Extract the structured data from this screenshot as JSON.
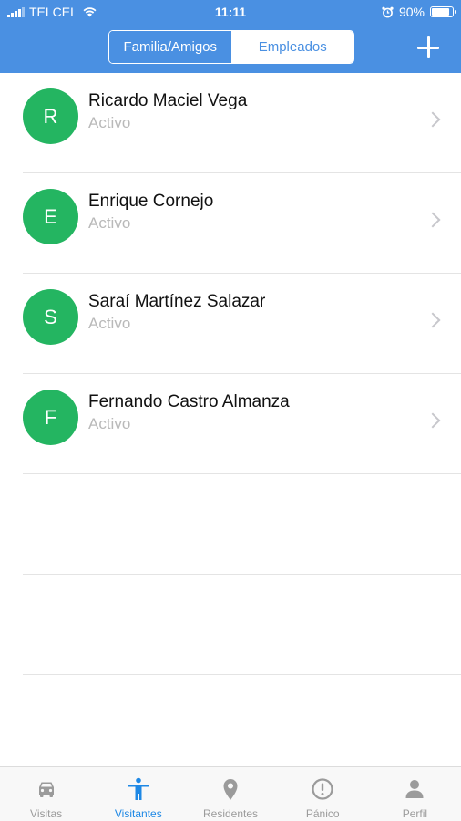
{
  "status_bar": {
    "carrier": "TELCEL",
    "time": "11:11",
    "battery_percent": "90%",
    "battery_level": 0.9
  },
  "header": {
    "segments": [
      {
        "label": "Familia/Amigos",
        "selected": true
      },
      {
        "label": "Empleados",
        "selected": false
      }
    ],
    "add_icon": "plus-icon"
  },
  "visitors": [
    {
      "initial": "R",
      "name": "Ricardo Maciel Vega",
      "status": "Activo"
    },
    {
      "initial": "E",
      "name": "Enrique Cornejo",
      "status": "Activo"
    },
    {
      "initial": "S",
      "name": "Saraí Martínez Salazar",
      "status": "Activo"
    },
    {
      "initial": "F",
      "name": "Fernando Castro Almanza",
      "status": "Activo"
    }
  ],
  "tabbar": {
    "tabs": [
      {
        "label": "Visitas",
        "icon": "car-icon",
        "active": false
      },
      {
        "label": "Visitantes",
        "icon": "person-icon",
        "active": true
      },
      {
        "label": "Residentes",
        "icon": "location-pin-icon",
        "active": false
      },
      {
        "label": "Pánico",
        "icon": "alert-circle-icon",
        "active": false
      },
      {
        "label": "Perfil",
        "icon": "user-icon",
        "active": false
      }
    ]
  },
  "colors": {
    "header": "#4a90e2",
    "avatar": "#24b561",
    "active_tab": "#1e88e5",
    "inactive_tab": "#9b9b9b"
  }
}
